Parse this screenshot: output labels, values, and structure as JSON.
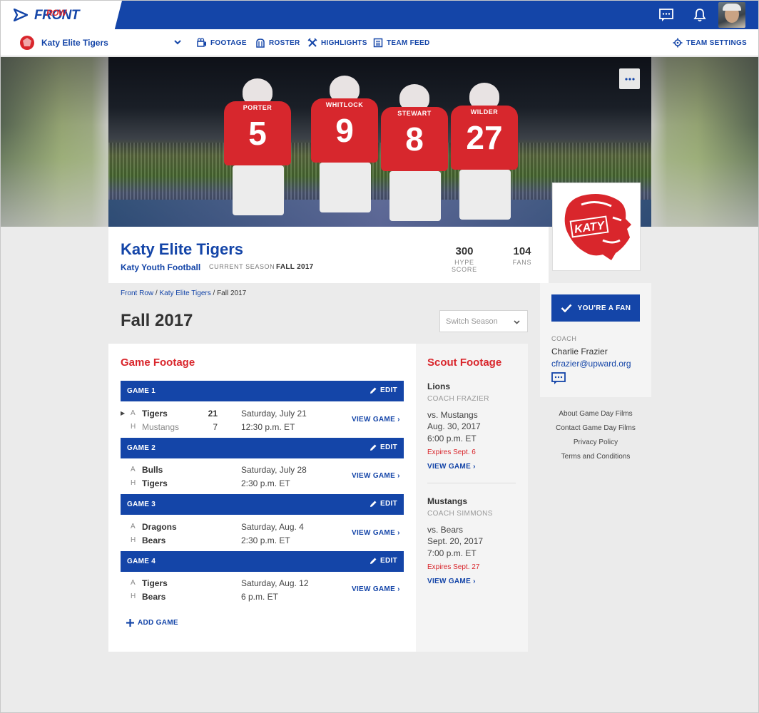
{
  "app": {
    "logo_front": "FRONT",
    "logo_row": "ROW"
  },
  "colors": {
    "brand_blue": "#1445a8",
    "accent_red": "#d9262c"
  },
  "nav": {
    "team_name": "Katy Elite Tigers",
    "items": [
      {
        "label": "FOOTAGE",
        "icon": "film-camera-icon"
      },
      {
        "label": "ROSTER",
        "icon": "roster-icon"
      },
      {
        "label": "HIGHLIGHTS",
        "icon": "highlights-icon"
      },
      {
        "label": "TEAM FEED",
        "icon": "feed-icon"
      }
    ],
    "settings_label": "TEAM SETTINGS"
  },
  "hero": {
    "players": [
      {
        "name": "PORTER",
        "number": "5"
      },
      {
        "name": "WHITLOCK",
        "number": "9"
      },
      {
        "name": "STEWART",
        "number": "8"
      },
      {
        "name": "WILDER",
        "number": "27"
      }
    ],
    "crest_text": "KATY"
  },
  "team": {
    "name": "Katy Elite Tigers",
    "league": "Katy Youth Football",
    "season_label": "CURRENT SEASON",
    "season_value": "FALL 2017",
    "hype_score": "300",
    "hype_label": "HYPE SCORE",
    "fans": "104",
    "fans_label": "FANS"
  },
  "breadcrumb": {
    "home": "Front Row",
    "team": "Katy Elite Tigers",
    "current": "Fall 2017",
    "sep": "/"
  },
  "page": {
    "title": "Fall 2017",
    "switch_season_placeholder": "Switch Season"
  },
  "game_footage": {
    "title": "Game Footage",
    "edit_label": "EDIT",
    "view_label": "VIEW GAME",
    "add_label": "ADD GAME",
    "games": [
      {
        "title": "GAME 1",
        "rows": [
          {
            "ha": "A",
            "team": "Tigers",
            "score": "21",
            "info": "Saturday, July 21"
          },
          {
            "ha": "H",
            "team": "Mustangs",
            "score": "7",
            "info": "12:30 p.m. ET"
          }
        ]
      },
      {
        "title": "GAME 2",
        "rows": [
          {
            "ha": "A",
            "team": "Bulls",
            "score": "",
            "info": "Saturday, July 28"
          },
          {
            "ha": "H",
            "team": "Tigers",
            "score": "",
            "info": "2:30 p.m. ET"
          }
        ]
      },
      {
        "title": "GAME 3",
        "rows": [
          {
            "ha": "A",
            "team": "Dragons",
            "score": "",
            "info": "Saturday, Aug. 4"
          },
          {
            "ha": "H",
            "team": "Bears",
            "score": "",
            "info": "2:30 p.m. ET"
          }
        ]
      },
      {
        "title": "GAME 4",
        "rows": [
          {
            "ha": "A",
            "team": "Tigers",
            "score": "",
            "info": "Saturday, Aug. 12"
          },
          {
            "ha": "H",
            "team": "Bears",
            "score": "",
            "info": "6 p.m. ET"
          }
        ]
      }
    ]
  },
  "scout_footage": {
    "title": "Scout Footage",
    "view_label": "VIEW GAME",
    "entries": [
      {
        "team": "Lions",
        "coach": "COACH FRAZIER",
        "vs": "vs. Mustangs",
        "date": "Aug. 30, 2017",
        "time": "6:00 p.m. ET",
        "expires": "Expires Sept. 6"
      },
      {
        "team": "Mustangs",
        "coach": "COACH SIMMONS",
        "vs": "vs. Bears",
        "date": "Sept. 20, 2017",
        "time": "7:00 p.m. ET",
        "expires": "Expires Sept. 27"
      }
    ]
  },
  "sidebar": {
    "fan_button": "YOU'RE A FAN",
    "coach_label": "COACH",
    "coach_name": "Charlie Frazier",
    "coach_email": "cfrazier@upward.org",
    "footer_links": [
      "About Game Day Films",
      "Contact Game Day Films",
      "Privacy Policy",
      "Terms and Conditions"
    ]
  }
}
